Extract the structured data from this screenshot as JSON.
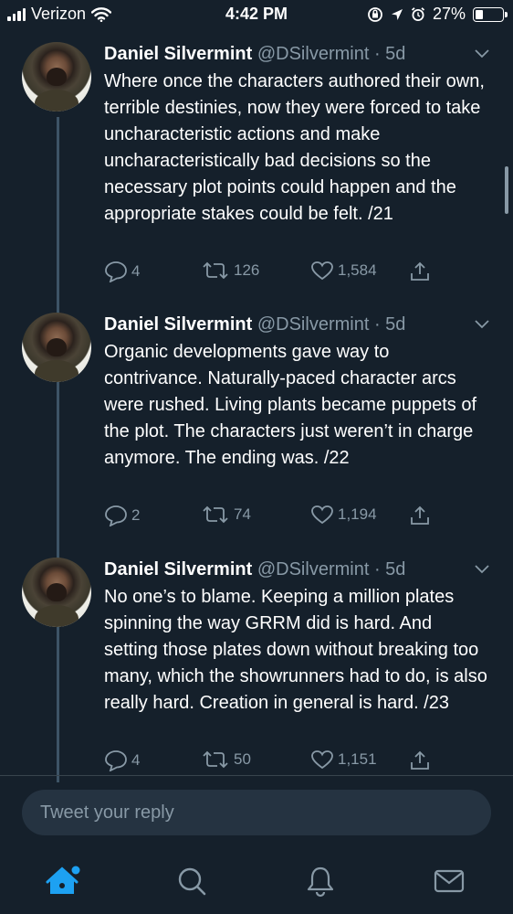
{
  "status_bar": {
    "carrier": "Verizon",
    "time": "4:42 PM",
    "battery": "27%"
  },
  "tweets": [
    {
      "name": "Daniel Silvermint",
      "handle": "@DSilvermint",
      "age": "· 5d",
      "text": "Where once the characters authored their own, terrible destinies, now they were forced to take uncharacteristic actions and make uncharacteristically bad decisions so the necessary plot points could happen and the appropriate stakes could be felt.  /21",
      "replies": "4",
      "retweets": "126",
      "likes": "1,584"
    },
    {
      "name": "Daniel Silvermint",
      "handle": "@DSilvermint",
      "age": "· 5d",
      "text": "Organic developments gave way to contrivance. Naturally-paced character arcs were rushed. Living plants became puppets of the plot. The characters just weren’t in charge anymore. The ending was.  /22",
      "replies": "2",
      "retweets": "74",
      "likes": "1,194"
    },
    {
      "name": "Daniel Silvermint",
      "handle": "@DSilvermint",
      "age": "· 5d",
      "text": "No one’s to blame. Keeping a million plates spinning the way GRRM did is hard. And setting those plates down without breaking too many, which the showrunners had to do, is also really hard. Creation in general is hard.  /23",
      "replies": "4",
      "retweets": "50",
      "likes": "1,151"
    }
  ],
  "reply": {
    "placeholder": "Tweet your reply"
  },
  "tab_bar": {
    "items": [
      "home-icon",
      "search-icon",
      "notifications-icon",
      "messages-icon"
    ],
    "active_color": "#1da1f2"
  },
  "colors": {
    "background": "#15202b",
    "secondary_text": "#8899a6",
    "accent": "#1da1f2"
  }
}
